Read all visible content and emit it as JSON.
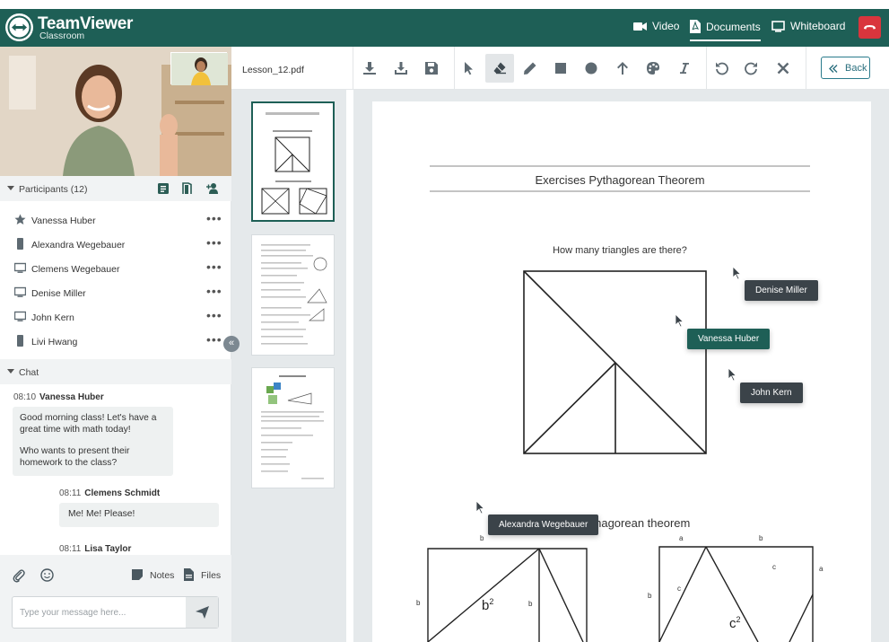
{
  "header": {
    "brand": "TeamViewer",
    "brand_sub": "Classroom",
    "nav": [
      {
        "label": "Video",
        "icon": "video-camera-icon"
      },
      {
        "label": "Documents",
        "icon": "pdf-document-icon",
        "active": true
      },
      {
        "label": "Whiteboard",
        "icon": "monitor-icon"
      }
    ],
    "hangup_icon": "phone-hangup-icon"
  },
  "participants": {
    "title": "Participants (12)",
    "list": [
      {
        "name": "Vanessa Huber",
        "icon": "star-icon"
      },
      {
        "name": "Alexandra Wegebauer",
        "icon": "mobile-icon"
      },
      {
        "name": "Clemens Wegebauer",
        "icon": "monitor-icon"
      },
      {
        "name": "Denise Miller",
        "icon": "monitor-icon"
      },
      {
        "name": "John Kern",
        "icon": "monitor-icon"
      },
      {
        "name": "Livi Hwang",
        "icon": "mobile-icon"
      }
    ]
  },
  "chat": {
    "title": "Chat",
    "messages": [
      {
        "time": "08:10",
        "author": "Vanessa Huber",
        "line1": "Good morning class! Let's have a great time with math today!",
        "line2": "Who wants to present their homework to the class?"
      },
      {
        "time": "08:11",
        "author": "Clemens Schmidt",
        "line1": "Me! Me! Please!"
      },
      {
        "time": "08:11",
        "author": "Lisa Taylor"
      }
    ],
    "notes_label": "Notes",
    "files_label": "Files",
    "input_placeholder": "Type your message here..."
  },
  "document": {
    "file_name": "Lesson_12.pdf",
    "back_label": "Back",
    "title": "Exercises Pythagorean Theorem",
    "question": "How many triangles are there?",
    "subtitle_partial": "ythagorean theorem",
    "labels": {
      "b": "b",
      "a": "a",
      "c": "c",
      "b2": "b",
      "c2": "c",
      "sup": "2"
    }
  },
  "cursors": [
    {
      "name": "Denise Miller"
    },
    {
      "name": "Vanessa Huber",
      "highlight": true
    },
    {
      "name": "John Kern"
    },
    {
      "name": "Alexandra Wegebauer"
    }
  ],
  "colors": {
    "brand": "#1e5f56",
    "hangup": "#d9353d",
    "accent": "#2a7b8c"
  }
}
